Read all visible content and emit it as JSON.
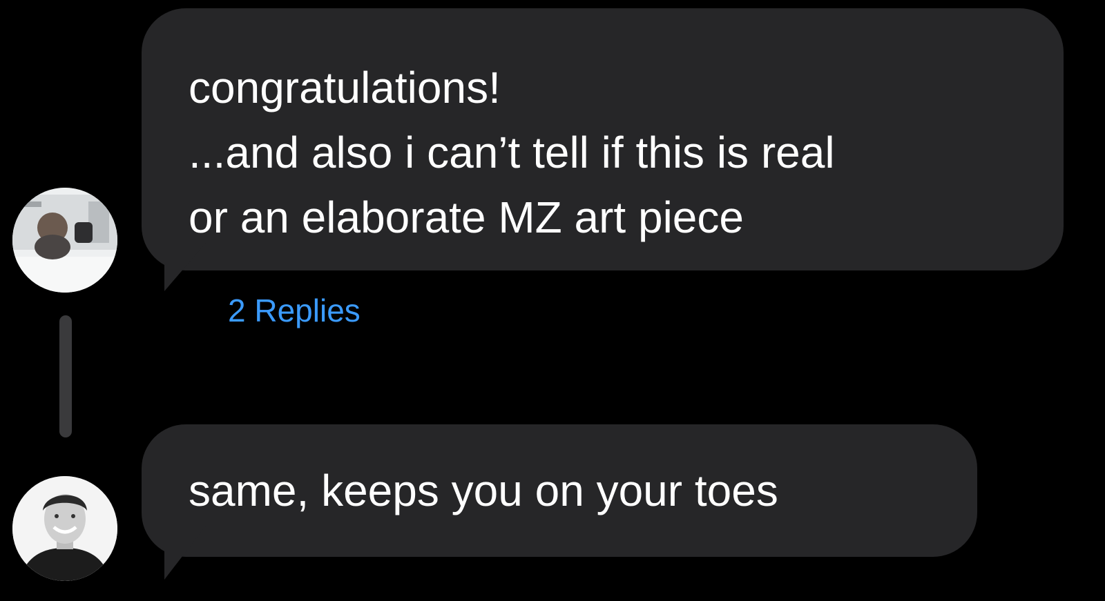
{
  "messages": [
    {
      "lines": [
        "congratulations!",
        "...and also i can’t tell if this is real",
        "or an elaborate MZ art piece"
      ],
      "replies_label": "2 Replies"
    },
    {
      "lines": [
        "same, keeps you on your toes"
      ]
    }
  ],
  "colors": {
    "background": "#000000",
    "bubble": "#262628",
    "text": "#ffffff",
    "link": "#3b9bff",
    "thread_line": "#3a3a3c"
  },
  "icons": {
    "avatar_1": "user-photo-avatar",
    "avatar_2": "user-photo-avatar"
  }
}
